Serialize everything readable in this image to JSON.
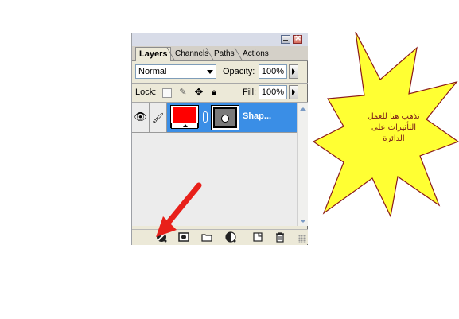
{
  "tabs": [
    {
      "label": "Layers",
      "active": true
    },
    {
      "label": "Channels",
      "active": false
    },
    {
      "label": "Paths",
      "active": false
    },
    {
      "label": "Actions",
      "active": false
    }
  ],
  "menu_flyout": "»",
  "blend_mode": "Normal",
  "opacity": {
    "label": "Opacity:",
    "value": "100%"
  },
  "lock": {
    "label": "Lock:"
  },
  "fill": {
    "label": "Fill:",
    "value": "100%"
  },
  "layer": {
    "name": "Shap...",
    "fill_color": "#ff0000",
    "selected": true
  },
  "bottom_icons": [
    "link-layers-icon",
    "layer-style-icon",
    "add-mask-icon",
    "new-group-icon",
    "adjustment-layer-icon",
    "new-layer-icon",
    "delete-layer-icon"
  ],
  "callout": {
    "text_lines": [
      "تذهب هنا للعمل",
      "التأثيرات على",
      "الدائرة"
    ],
    "fill_color": "#ffff33",
    "stroke_color": "#8b1a1a",
    "text_color": "#7a1a1a"
  },
  "arrow_color": "#e8201a"
}
